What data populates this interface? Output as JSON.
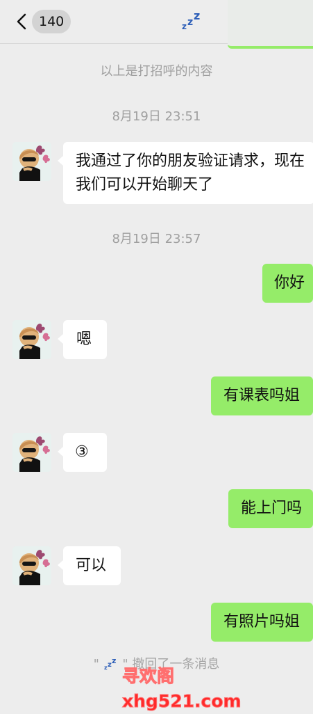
{
  "header": {
    "back_label": "<",
    "unread_count": "140",
    "title_icon": "sleep-zzz-icon"
  },
  "system": {
    "greeting_info": "以上是打招呼的内容",
    "timestamp_1": "8月19日 23:51",
    "timestamp_2": "8月19日 23:57"
  },
  "messages": [
    {
      "side": "in",
      "text": "我通过了你的朋友验证请求，现在我们可以开始聊天了"
    },
    {
      "side": "out",
      "text": "你好"
    },
    {
      "side": "in",
      "text": "嗯"
    },
    {
      "side": "out",
      "text": "有课表吗姐"
    },
    {
      "side": "in",
      "text": "③"
    },
    {
      "side": "out",
      "text": "能上门吗"
    },
    {
      "side": "in",
      "text": "可以"
    },
    {
      "side": "out",
      "text": "有照片吗姐"
    }
  ],
  "recall_notice": {
    "prefix": "\"",
    "icon": "sleep-zzz-icon",
    "suffix": "\" 撤回了一条消息"
  },
  "watermark": "寻欢阁xhg521.com",
  "colors": {
    "background": "#ededed",
    "outgoing_bubble": "#95ec69",
    "incoming_bubble": "#ffffff",
    "system_text": "#9f9f9f",
    "zzz_icon": "#2e5fb8",
    "watermark": "#ff2a2a"
  }
}
